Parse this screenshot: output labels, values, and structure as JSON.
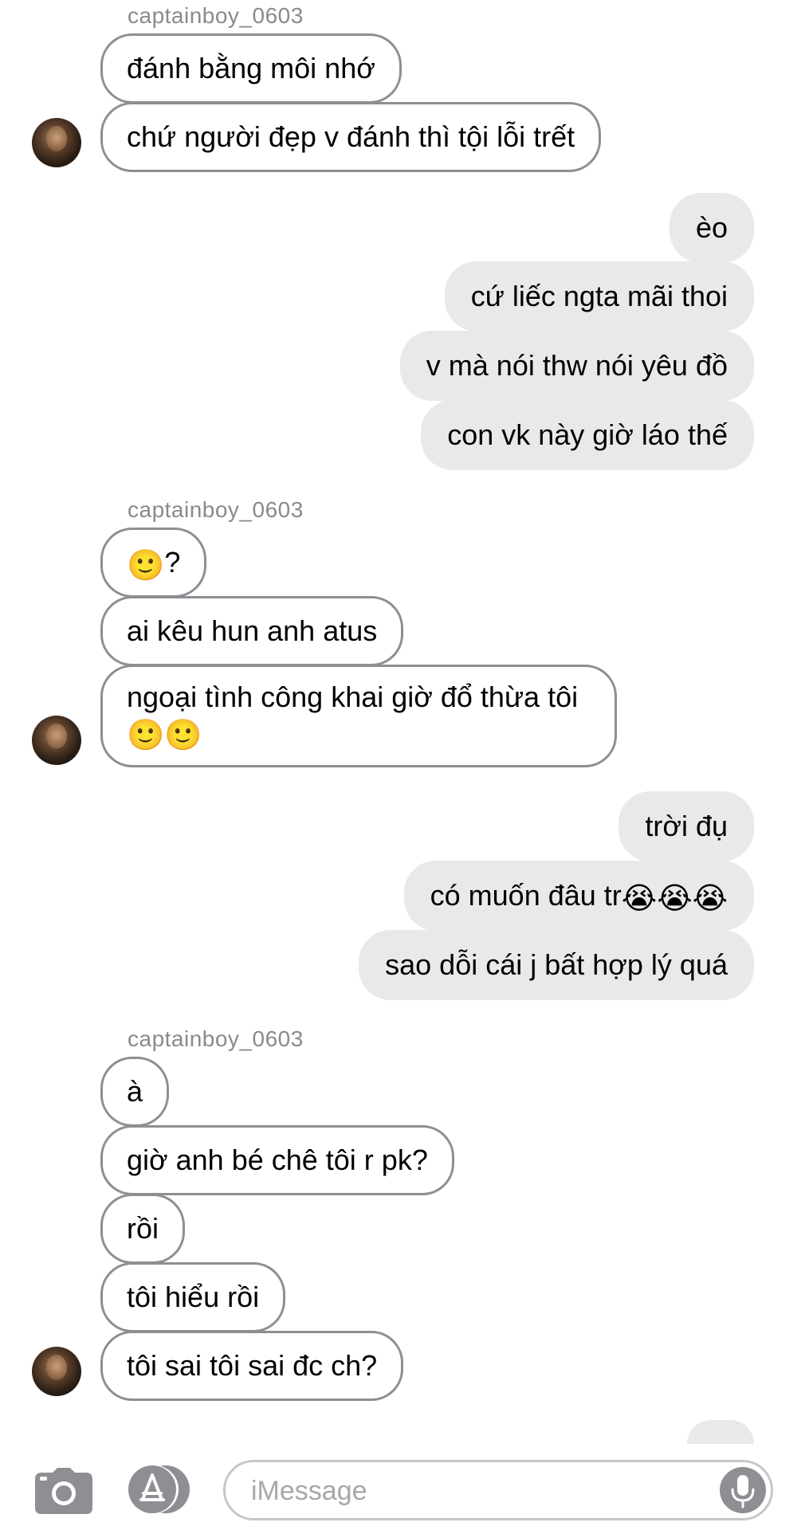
{
  "conversation": {
    "groups": [
      {
        "sender": "captainboy_0603",
        "messages": [
          "đánh bằng môi nhớ",
          "chứ người đẹp v đánh thì tội lỗi trết"
        ]
      },
      {
        "messages": [
          "èo",
          "cứ liếc ngta mãi thoi",
          "v mà nói thw nói yêu đồ",
          "con vk này giờ láo thế"
        ]
      },
      {
        "sender": "captainboy_0603",
        "messages": [
          "?",
          "ai kêu hun anh atus",
          "ngoại tình công khai giờ đổ thừa tôi"
        ]
      },
      {
        "messages": [
          "trời đụ",
          "có muốn đâu tr",
          "sao dỗi cái j bất hợp lý quá"
        ]
      },
      {
        "sender": "captainboy_0603",
        "messages": [
          "à",
          "giờ anh bé chê tôi r pk?",
          "rồi",
          "tôi hiểu rồi",
          "tôi sai tôi sai đc ch?"
        ]
      }
    ],
    "emoji": {
      "slight_smile": "🙂",
      "loudly_crying": "😭"
    }
  },
  "input_bar": {
    "placeholder": "iMessage",
    "icons": [
      "camera-icon",
      "app-store-icon",
      "microphone-icon"
    ]
  },
  "colors": {
    "outgoing_bubble": "#e9e9eb",
    "incoming_border": "#8e8e93",
    "sender_name": "#8a8a8e",
    "placeholder": "#a7a7ac"
  }
}
